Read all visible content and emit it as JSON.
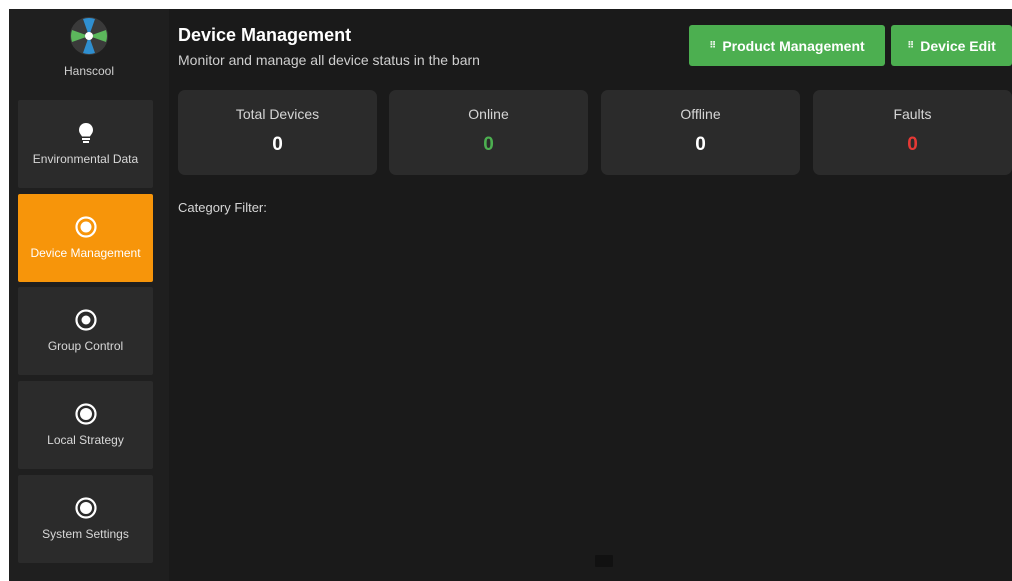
{
  "brand": {
    "name": "Hanscool",
    "logo_icon": "fan-logo-icon"
  },
  "sidebar": {
    "items": [
      {
        "label": "Environmental Data",
        "icon": "lightbulb-icon",
        "active": false
      },
      {
        "label": "Device Management",
        "icon": "radio-dot-icon",
        "active": true
      },
      {
        "label": "Group Control",
        "icon": "radio-dot-icon",
        "active": false
      },
      {
        "label": "Local Strategy",
        "icon": "radio-dot-icon",
        "active": false
      },
      {
        "label": "System Settings",
        "icon": "radio-dot-icon",
        "active": false
      }
    ]
  },
  "header": {
    "title": "Device Management",
    "subtitle": "Monitor and manage all device status in the barn",
    "product_button": "Product Management",
    "edit_button": "Device Edit",
    "button_icon": "grid-dots-icon"
  },
  "stats": [
    {
      "label": "Total Devices",
      "value": "0"
    },
    {
      "label": "Online",
      "value": "0"
    },
    {
      "label": "Offline",
      "value": "0"
    },
    {
      "label": "Faults",
      "value": "0"
    }
  ],
  "filter": {
    "label": "Category Filter:"
  },
  "colors": {
    "background": "#1a1a1a",
    "sidebar": "#1f1f1f",
    "card": "#2b2b2b",
    "active": "#f7950a",
    "button": "#4caf50",
    "online": "#4caf50",
    "fault": "#e53935"
  }
}
